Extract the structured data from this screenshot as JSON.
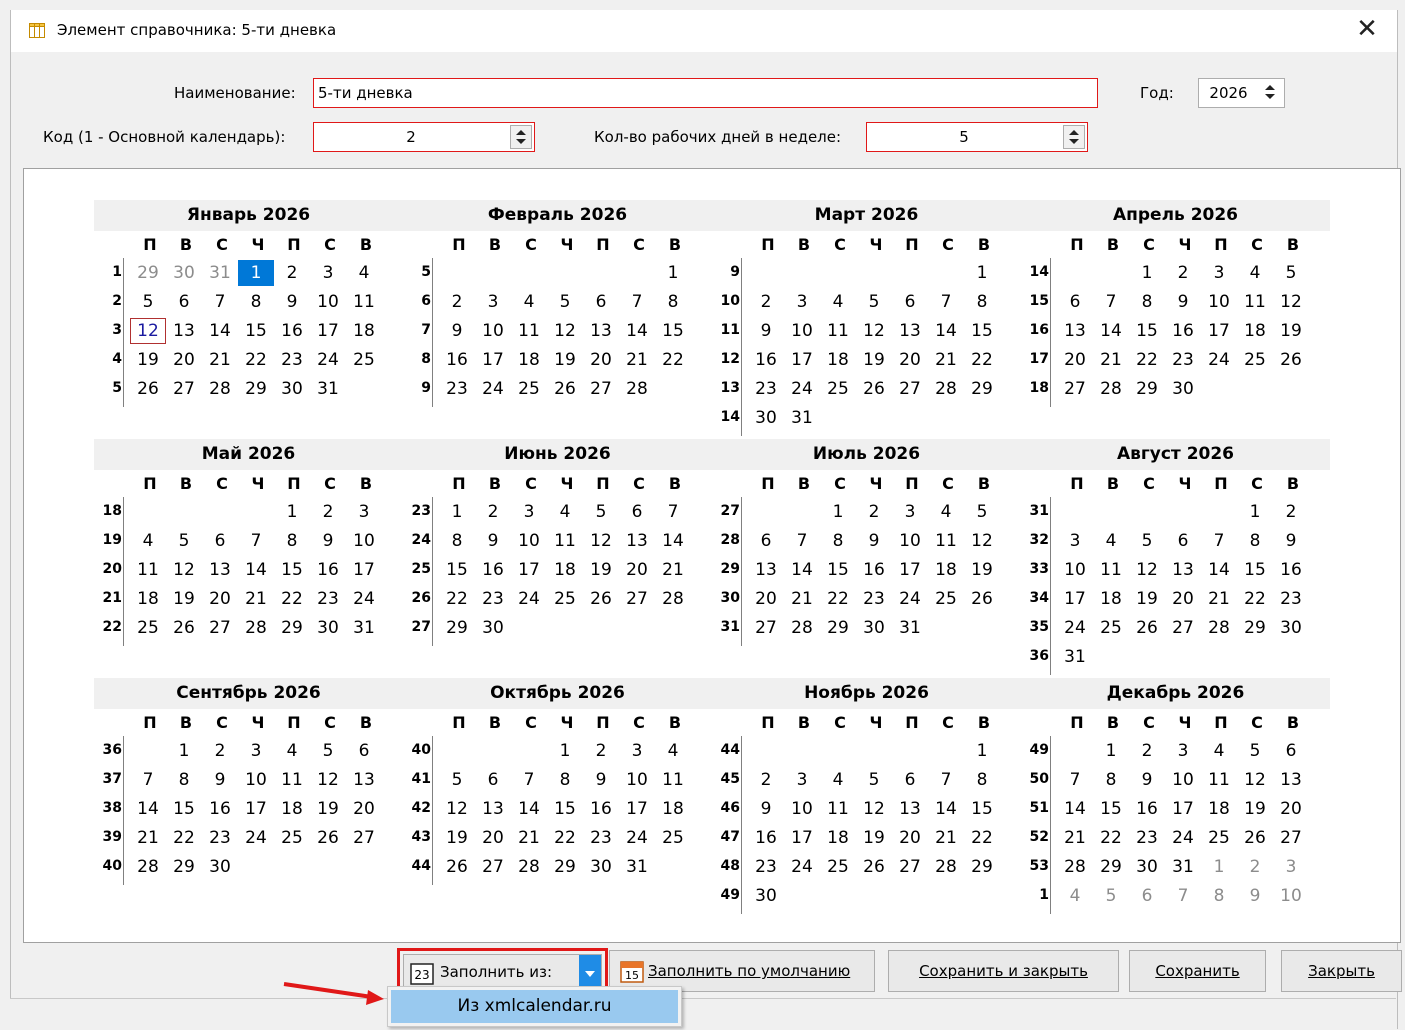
{
  "window": {
    "title": "Элемент справочника: 5-ти дневка",
    "close_glyph": "✕"
  },
  "form": {
    "name_label": "Наименование:",
    "name_value": "5-ти дневка",
    "year_label": "Год:",
    "year_value": "2026",
    "code_label": "Код (1 - Основной календарь):",
    "code_value": "2",
    "workdays_label": "Кол-во рабочих дней в неделе:",
    "workdays_value": "5"
  },
  "calendar": {
    "year": 2026,
    "dow": [
      "П",
      "В",
      "С",
      "Ч",
      "П",
      "С",
      "В"
    ],
    "today": {
      "month": 1,
      "day": 1
    },
    "selected": {
      "month": 1,
      "day": 12
    },
    "months": [
      {
        "title": "Январь 2026",
        "weeks": [
          1,
          2,
          3,
          4,
          5
        ]
      },
      {
        "title": "Февраль 2026",
        "weeks": [
          5,
          6,
          7,
          8,
          9
        ]
      },
      {
        "title": "Март 2026",
        "weeks": [
          9,
          10,
          11,
          12,
          13,
          14
        ]
      },
      {
        "title": "Апрель 2026",
        "weeks": [
          14,
          15,
          16,
          17,
          18
        ]
      },
      {
        "title": "Май 2026",
        "weeks": [
          18,
          19,
          20,
          21,
          22
        ]
      },
      {
        "title": "Июнь 2026",
        "weeks": [
          23,
          24,
          25,
          26,
          27
        ]
      },
      {
        "title": "Июль 2026",
        "weeks": [
          27,
          28,
          29,
          30,
          31
        ]
      },
      {
        "title": "Август 2026",
        "weeks": [
          31,
          32,
          33,
          34,
          35,
          36
        ]
      },
      {
        "title": "Сентябрь 2026",
        "weeks": [
          36,
          37,
          38,
          39,
          40
        ]
      },
      {
        "title": "Октябрь 2026",
        "weeks": [
          40,
          41,
          42,
          43,
          44
        ]
      },
      {
        "title": "Ноябрь 2026",
        "weeks": [
          44,
          45,
          46,
          47,
          48,
          49
        ]
      },
      {
        "title": "Декабрь 2026",
        "weeks": [
          49,
          50,
          51,
          52,
          53,
          1
        ]
      }
    ]
  },
  "buttons": {
    "fill_from": "Заполнить из:",
    "fill_default": "Заполнить по умолчанию",
    "save_close": "Сохранить и закрыть",
    "save": "Сохранить",
    "close": "Закрыть",
    "fill_from_icon_text": "23",
    "fill_default_icon_text": "15"
  },
  "popup": {
    "item": "Из xmlcalendar.ru"
  },
  "colors": {
    "accent": "#0078d7",
    "highlight_border": "#e01818",
    "popup_selected": "#99c9ef",
    "arrow": "#e01818"
  }
}
